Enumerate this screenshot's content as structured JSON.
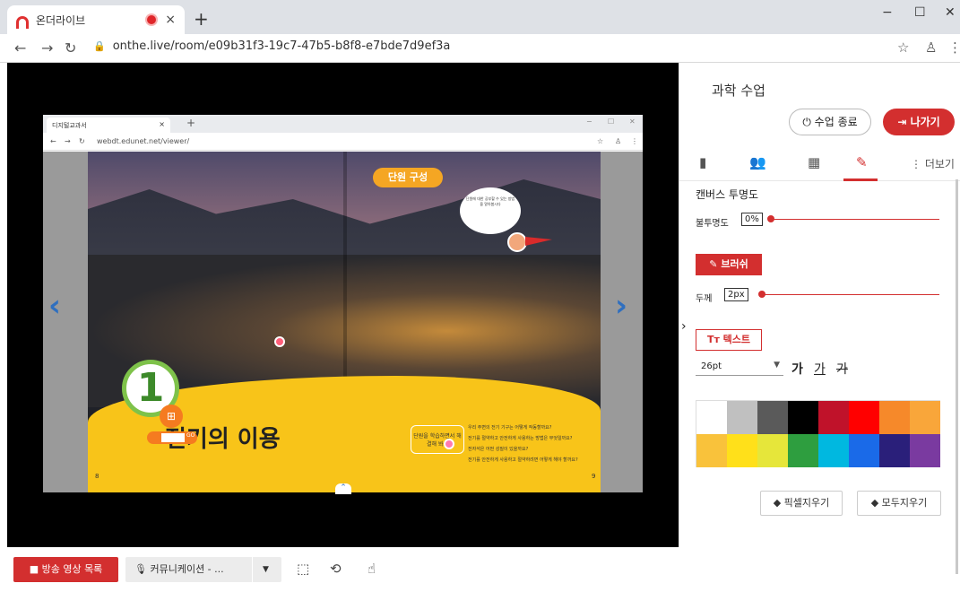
{
  "browser": {
    "tab_title": "온더라이브",
    "tab_close": "×",
    "new_tab": "+",
    "url": "onthe.live/room/e09b31f3-19c7-47b5-b8f8-e7bde7d9ef3a",
    "win_min": "−",
    "win_max": "☐",
    "win_close": "✕"
  },
  "shared_screen": {
    "tab_title": "디지털교과서",
    "tab_close": "×",
    "new_tab": "+",
    "url": "webdt.edunet.net/viewer/",
    "unit_title": "단원 구성",
    "bubble_text": "단원에 대한 공부할 수 있는 방법을 알아봅시다",
    "chapter_number": "1",
    "chapter_title": "전기의 이용",
    "study_box": "단원을 학습하면서 해결해 봐요",
    "study_items": [
      "우리 주변의 전기 기구는 어떻게 작동할까요?",
      "전기를 절약하고 안전하게 사용하는 방법은 무엇일까요?",
      "전자석은 어떤 성질이 있을까요?",
      "전기를 안전하게 사용하고 절약하려면 어떻게 해야 할까요?"
    ],
    "page_left": "8",
    "page_right": "9",
    "widget_label": "GO"
  },
  "panel": {
    "class_title": "과학 수업",
    "end_button": "수업 종료",
    "exit_button": "나가기",
    "more_tab": "더보기",
    "canvas_opacity_title": "캔버스 투명도",
    "opacity_label": "불투명도",
    "opacity_value": "0%",
    "opacity_level": 0.0,
    "brush_button": "브러쉬",
    "thickness_label": "두께",
    "thickness_value": "2px",
    "thickness_level": 0.02,
    "text_button": "텍스트",
    "font_size": "26pt",
    "font_bold": "가",
    "font_underline": "가",
    "font_strike": "가",
    "palette": [
      "#ffffff",
      "#c0c0c0",
      "#5a5a5a",
      "#000000",
      "#c0122a",
      "#ff0000",
      "#f6892a",
      "#f9a63a",
      "#f9c23b",
      "#ffe01a",
      "#e6e63a",
      "#2e9e3f",
      "#00b8e0",
      "#1a6ae8",
      "#2a1f7a",
      "#7a3aa0"
    ],
    "pixel_erase_button": "픽셀지우기",
    "erase_all_button": "모두지우기"
  },
  "bottombar": {
    "broadcast_button": "방송 영상 목록",
    "comm_button": "커뮤니케이션 - ..."
  }
}
